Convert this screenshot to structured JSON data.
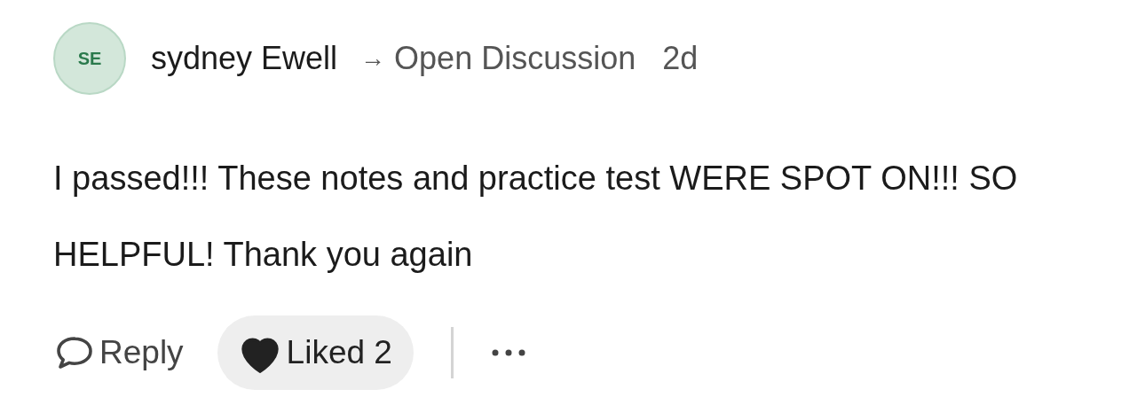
{
  "comment": {
    "avatar": {
      "initials": "SE"
    },
    "author": "sydney Ewell",
    "arrow": "→",
    "destination": "Open Discussion",
    "time": "2d",
    "body": "I passed!!! These notes and practice test WERE SPOT ON!!! SO HELPFUL! Thank you again",
    "actions": {
      "reply": "Reply",
      "like": {
        "label": "Liked",
        "count": "2",
        "liked": true
      }
    }
  }
}
